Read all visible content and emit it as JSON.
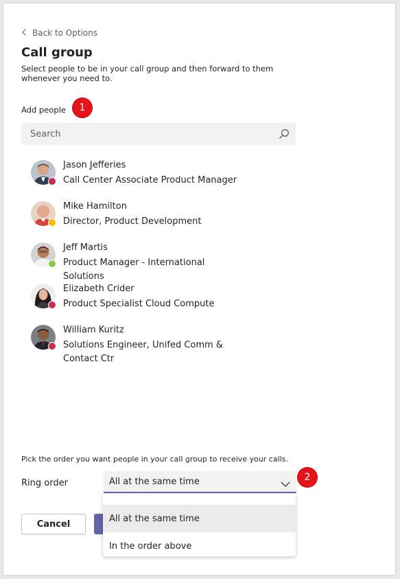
{
  "back_link": "Back to Options",
  "title": "Call group",
  "description": "Select people to be in your call group and then forward to them whenever you need to.",
  "add_people_label": "Add people",
  "step_badges": [
    "1",
    "2"
  ],
  "search": {
    "placeholder": "Search"
  },
  "people": [
    {
      "name": "Jason Jefferies",
      "title": "Call Center Associate Product Manager",
      "presence": "busy",
      "presence_color": "#c4314b"
    },
    {
      "name": "Mike Hamilton",
      "title": "Director, Product Development",
      "presence": "away",
      "presence_color": "#fcb900"
    },
    {
      "name": "Jeff Martis",
      "title": "Product Manager - International Solutions",
      "presence": "available",
      "presence_color": "#92c353"
    },
    {
      "name": "Elizabeth Crider",
      "title": "Product Specialist Cloud Compute",
      "presence": "busy",
      "presence_color": "#c4314b"
    },
    {
      "name": "William Kuritz",
      "title": "Solutions Engineer, Unifed Comm & Contact Ctr",
      "presence": "busy",
      "presence_color": "#c4314b"
    }
  ],
  "order_hint": "Pick the order you want people in your call group to receive your calls.",
  "ring_order": {
    "label": "Ring order",
    "selected": "All at the same time",
    "options": [
      "All at the same time",
      "In the order above"
    ]
  },
  "buttons": {
    "cancel": "Cancel"
  },
  "colors": {
    "accent": "#6264a7",
    "badge": "#e6141a"
  }
}
